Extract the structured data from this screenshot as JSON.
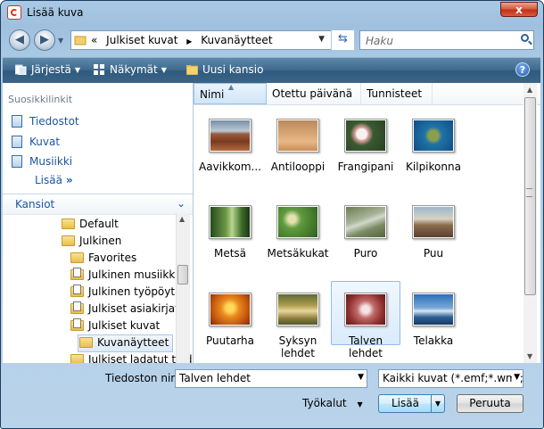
{
  "window": {
    "title": "Lisää kuva",
    "close_label": "x"
  },
  "address": {
    "crumbs": [
      "«",
      "Julkiset kuvat",
      "▶",
      "Kuvanäytteet"
    ],
    "search_placeholder": "Haku"
  },
  "toolbar": {
    "organize": "Järjestä",
    "views": "Näkymät",
    "new_folder": "Uusi kansio",
    "help": "?"
  },
  "sidebar": {
    "favorites_heading": "Suosikkilinkit",
    "favorites": [
      {
        "label": "Tiedostot"
      },
      {
        "label": "Kuvat"
      },
      {
        "label": "Musiikki"
      }
    ],
    "more": "Lisää",
    "more_chevron": "»",
    "folders_heading": "Kansiot",
    "tree": [
      {
        "label": "Default"
      },
      {
        "label": "Julkinen"
      },
      {
        "label": "Favorites"
      },
      {
        "label": "Julkinen musiikki"
      },
      {
        "label": "Julkinen työpöytä"
      },
      {
        "label": "Julkiset asiakirjat"
      },
      {
        "label": "Julkiset kuvat"
      },
      {
        "label": "Kuvanäytteet"
      },
      {
        "label": "Julkiset ladatut tied"
      }
    ]
  },
  "columns": {
    "name": "Nimi",
    "date_taken": "Otettu päivänä",
    "tags": "Tunnisteet",
    "more": "»"
  },
  "files": [
    {
      "label": "Aavikkom..."
    },
    {
      "label": "Antilooppi"
    },
    {
      "label": "Frangipani"
    },
    {
      "label": "Kilpikonna"
    },
    {
      "label": "Metsä"
    },
    {
      "label": "Metsäkukat"
    },
    {
      "label": "Puro"
    },
    {
      "label": "Puu"
    },
    {
      "label": "Puutarha"
    },
    {
      "label": "Syksyn lehdet"
    },
    {
      "label": "Talven lehdet"
    },
    {
      "label": "Telakka"
    }
  ],
  "bottom": {
    "filename_label": "Tiedoston nimi:",
    "filename_value": "Talven lehdet",
    "filetype_value": "Kaikki kuvat (*.emf;*.wmf;*.jpg",
    "tools": "Työkalut",
    "insert": "Lisää",
    "cancel": "Peruuta"
  }
}
